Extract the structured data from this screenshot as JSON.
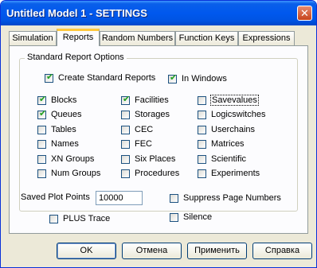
{
  "window": {
    "title": "Untitled Model 1 - SETTINGS",
    "close_glyph": "✕"
  },
  "tabs": [
    "Simulation",
    "Reports",
    "Random Numbers",
    "Function Keys",
    "Expressions"
  ],
  "active_tab": "Reports",
  "group": {
    "label": "Standard Report Options",
    "create_standard_reports": {
      "label": "Create Standard Reports",
      "checked": true
    },
    "in_windows": {
      "label": "In Windows",
      "checked": true
    },
    "col1": [
      {
        "label": "Blocks",
        "checked": true
      },
      {
        "label": "Queues",
        "checked": true
      },
      {
        "label": "Tables",
        "checked": false
      },
      {
        "label": "Names",
        "checked": false
      },
      {
        "label": "XN Groups",
        "checked": false
      },
      {
        "label": "Num Groups",
        "checked": false
      }
    ],
    "col2": [
      {
        "label": "Facilities",
        "checked": true
      },
      {
        "label": "Storages",
        "checked": false
      },
      {
        "label": "CEC",
        "checked": false
      },
      {
        "label": "FEC",
        "checked": false
      },
      {
        "label": "Six Places",
        "checked": false
      },
      {
        "label": "Procedures",
        "checked": false
      }
    ],
    "col3": [
      {
        "label": "Savevalues",
        "checked": false
      },
      {
        "label": "Logicswitches",
        "checked": false
      },
      {
        "label": "Userchains",
        "checked": false
      },
      {
        "label": "Matrices",
        "checked": false
      },
      {
        "label": "Scientific",
        "checked": false
      },
      {
        "label": "Experiments",
        "checked": false
      }
    ]
  },
  "saved_plot_points": {
    "label": "Saved Plot Points",
    "value": "10000"
  },
  "plus_trace": {
    "label": "PLUS Trace",
    "checked": false
  },
  "suppress_page_numbers": {
    "label": "Suppress Page Numbers",
    "checked": false
  },
  "silence": {
    "label": "Silence",
    "checked": false
  },
  "buttons": {
    "ok": "OK",
    "cancel": "Отмена",
    "apply": "Применить",
    "help": "Справка"
  },
  "colors": {
    "titlebar": "#0054e3",
    "tab_highlight": "#ffc83c",
    "face": "#ece9d8",
    "check": "#21a121"
  }
}
